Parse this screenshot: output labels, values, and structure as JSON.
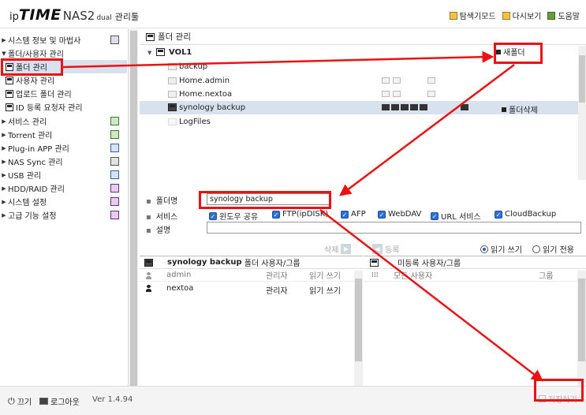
{
  "header": {
    "logo_ip": "ip",
    "logo_time": "TIME",
    "logo_nas": "NAS2",
    "logo_dual": "dual",
    "logo_admin": "관리툴",
    "links": [
      {
        "label": "탐색기모드",
        "icon": "explorer-mode-icon"
      },
      {
        "label": "다시보기",
        "icon": "refresh-icon"
      },
      {
        "label": "도움말",
        "icon": "help-icon"
      }
    ]
  },
  "sidebar": {
    "items": [
      {
        "label": "시스템 정보 및 마법사",
        "expanded": false
      },
      {
        "label": "폴더/사용자 관리",
        "expanded": true
      },
      {
        "label": "서비스 관리",
        "expanded": false
      },
      {
        "label": "Torrent 관리",
        "expanded": false
      },
      {
        "label": "Plug-in APP 관리",
        "expanded": false
      },
      {
        "label": "NAS Sync 관리",
        "expanded": false
      },
      {
        "label": "USB 관리",
        "expanded": false
      },
      {
        "label": "HDD/RAID 관리",
        "expanded": false
      },
      {
        "label": "시스템 설정",
        "expanded": false
      },
      {
        "label": "고급 기능 설정",
        "expanded": false
      }
    ],
    "subitems": [
      {
        "label": "폴더 관리",
        "active": true
      },
      {
        "label": "사용자 관리",
        "active": false
      },
      {
        "label": "업로드 폴더 관리",
        "active": false
      },
      {
        "label": "ID 등록 요청자 관리",
        "active": false
      }
    ]
  },
  "footer": {
    "off_label": "끄기",
    "logout_label": "로그아웃",
    "version": "Ver 1.4.94",
    "save_label": "저장하기"
  },
  "folder_panel": {
    "title": "폴더 관리",
    "volume": "VOL1",
    "new_folder_label": "새폴더",
    "delete_folder_label": "폴더삭제",
    "folders": [
      {
        "name": "backup",
        "selected": false
      },
      {
        "name": "Home.admin",
        "selected": false
      },
      {
        "name": "Home.nextoa",
        "selected": false
      },
      {
        "name": "synology backup",
        "selected": true
      },
      {
        "name": "LogFiles",
        "selected": false
      }
    ]
  },
  "form": {
    "name_label": "폴더명",
    "name_value": "synology backup",
    "service_label": "서비스",
    "desc_label": "설명",
    "desc_value": "",
    "services": [
      {
        "label": "윈도우 공유",
        "checked": true
      },
      {
        "label": "FTP(ipDISK)",
        "checked": true
      },
      {
        "label": "AFP",
        "checked": true
      },
      {
        "label": "WebDAV",
        "checked": true
      },
      {
        "label": "URL 서비스",
        "checked": true
      },
      {
        "label": "CloudBackup",
        "checked": true
      }
    ]
  },
  "user_controls": {
    "delete_label": "삭제",
    "register_label": "등록",
    "read_write_label": "읽기 쓰기",
    "read_only_label": "읽기 전용",
    "selected_mode": "read_write"
  },
  "users_left": {
    "title_folder": "synology backup",
    "title_suffix": "폴더 사용자/그룹",
    "columns": [
      "admin",
      "관리자",
      "읽기 쓰기"
    ],
    "rows": [
      {
        "name": "nextoa",
        "role": "관리자",
        "perm": "읽기 쓰기"
      }
    ]
  },
  "users_right": {
    "title": "미등록 사용자/그룹",
    "columns": [
      "모든 사용자",
      "그룹"
    ]
  },
  "colors": {
    "annotation": "#e11111",
    "selection": "#d7e2ee",
    "checkbox": "#2d6fd0"
  }
}
